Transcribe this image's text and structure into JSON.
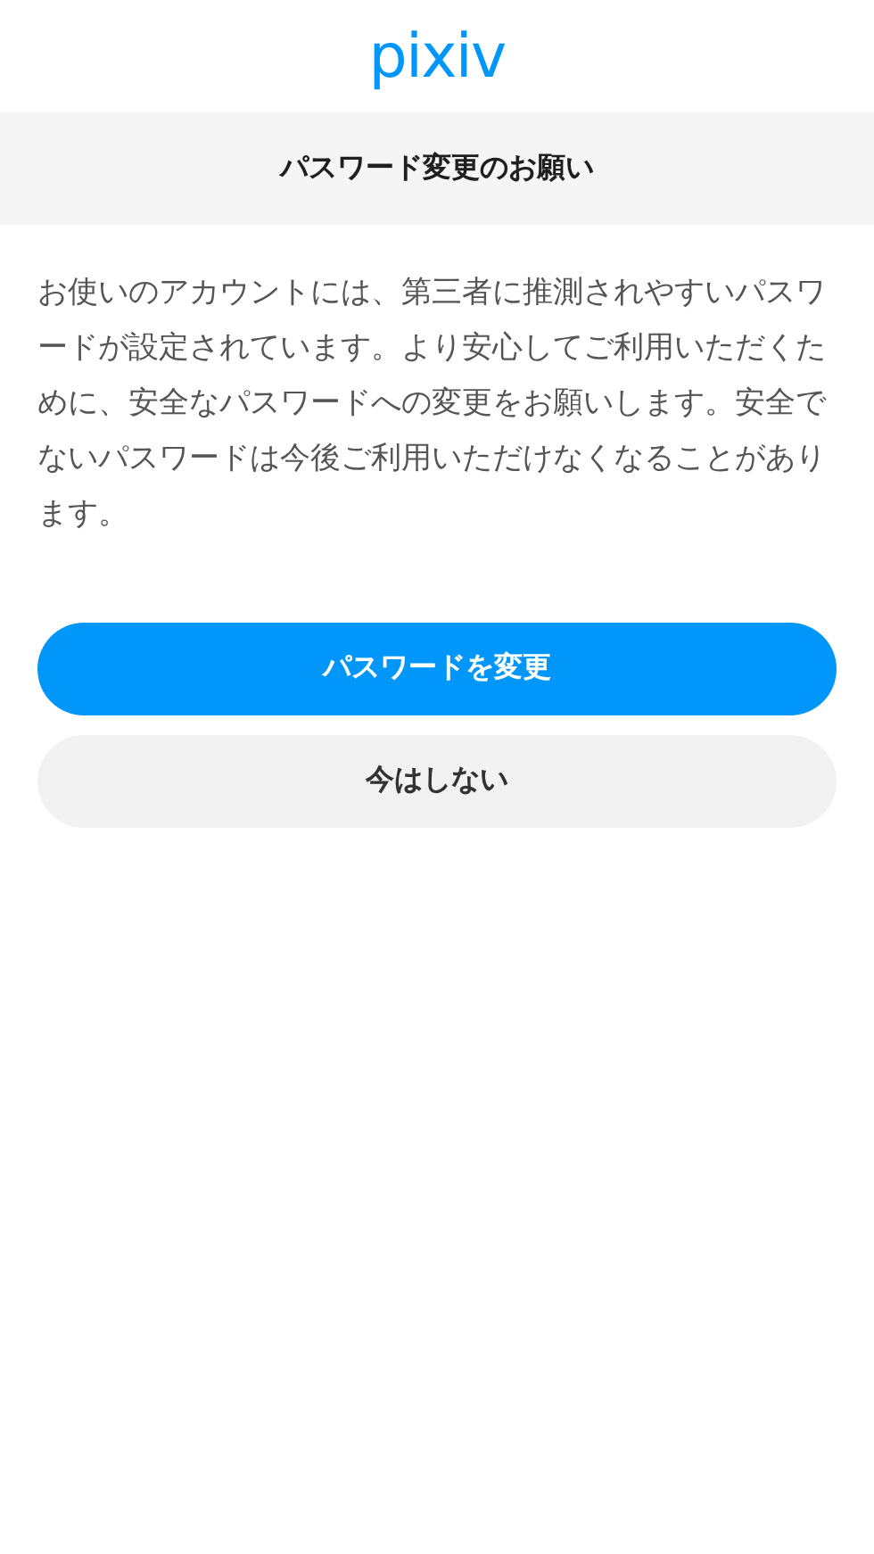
{
  "logo": "pixiv",
  "header": {
    "title": "パスワード変更のお願い"
  },
  "message": "お使いのアカウントには、第三者に推測されやすいパスワードが設定されています。より安心してご利用いただくために、安全なパスワードへの変更をお願いします。安全でないパスワードは今後ご利用いただけなくなることがあります。",
  "buttons": [
    {
      "label": "パスワードを変更",
      "kind": "primary"
    },
    {
      "label": "今はしない",
      "kind": "secondary"
    }
  ]
}
